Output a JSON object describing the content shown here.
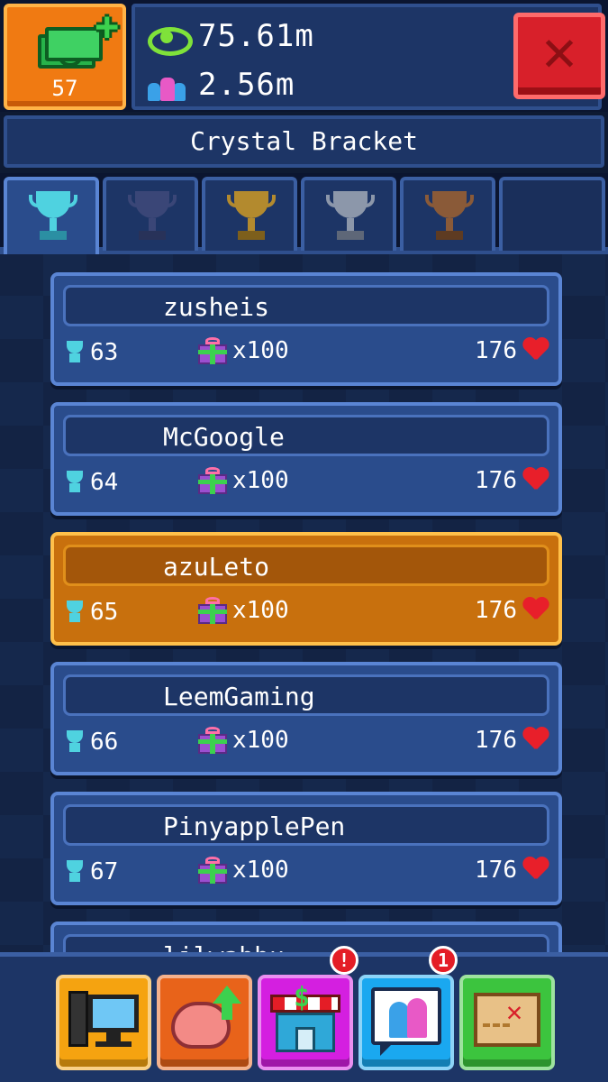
{
  "header": {
    "cash_count": "57",
    "views": "75.61m",
    "fans": "2.56m"
  },
  "bracket": {
    "title": "Crystal Bracket"
  },
  "tabs": [
    {
      "name": "crystal",
      "cup_color": "#4fd2e0",
      "active": true
    },
    {
      "name": "diamond",
      "cup_color": "#3a4677",
      "active": false
    },
    {
      "name": "gold",
      "cup_color": "#b38a2e",
      "active": false
    },
    {
      "name": "silver",
      "cup_color": "#8c97aa",
      "active": false
    },
    {
      "name": "bronze",
      "cup_color": "#8a5a38",
      "active": false
    },
    {
      "name": "empty",
      "cup_color": "",
      "active": false
    }
  ],
  "leaderboard": {
    "rows": [
      {
        "name": "zusheis",
        "rank": "63",
        "reward": "x100",
        "hearts": "176",
        "is_me": false
      },
      {
        "name": "McGoogle",
        "rank": "64",
        "reward": "x100",
        "hearts": "176",
        "is_me": false
      },
      {
        "name": "azuLeto",
        "rank": "65",
        "reward": "x100",
        "hearts": "176",
        "is_me": true
      },
      {
        "name": "LeemGaming",
        "rank": "66",
        "reward": "x100",
        "hearts": "176",
        "is_me": false
      },
      {
        "name": "PinyapplePen",
        "rank": "67",
        "reward": "x100",
        "hearts": "176",
        "is_me": false
      },
      {
        "name": "lilwabbu",
        "rank": "",
        "reward": "",
        "hearts": "",
        "is_me": false
      }
    ]
  },
  "bottom_nav": {
    "items": [
      {
        "name": "computer",
        "color": "#f5a310",
        "badge": ""
      },
      {
        "name": "upgrades",
        "color": "#e8631a",
        "badge": ""
      },
      {
        "name": "shop",
        "color": "#d41fe0",
        "badge": "!"
      },
      {
        "name": "social",
        "color": "#1aa8f0",
        "badge": "1"
      },
      {
        "name": "map",
        "color": "#3cc43e",
        "badge": ""
      }
    ]
  },
  "colors": {
    "accent_orange": "#f07a12",
    "panel_blue": "#1d3566",
    "highlight_row": "#c8700d",
    "close_red": "#d8202a"
  }
}
